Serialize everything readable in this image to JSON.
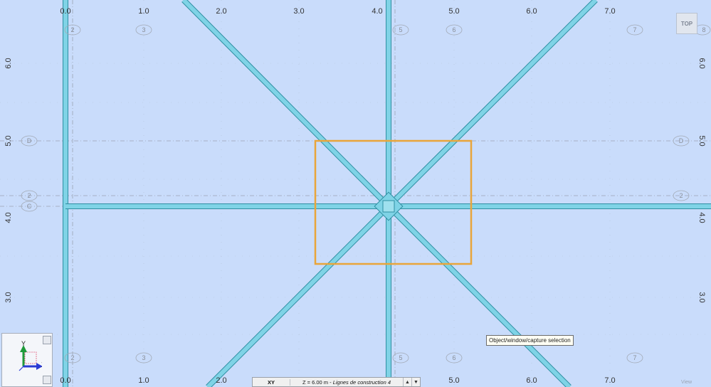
{
  "rulers": {
    "x_ticks": [
      "0.0",
      "1.0",
      "2.0",
      "3.0",
      "4.0",
      "5.0",
      "6.0",
      "7.0"
    ],
    "y_ticks": [
      "6.0",
      "5.0",
      "4.0",
      "3.0"
    ]
  },
  "grid_bubbles": {
    "top": [
      "2",
      "3",
      "5",
      "6",
      "7",
      "8"
    ],
    "left": [
      "D",
      "2",
      "C"
    ],
    "right": [
      "D",
      "2"
    ]
  },
  "view_cube": {
    "label": "TOP"
  },
  "tooltip": {
    "text": "Object/window/capture selection"
  },
  "axis_widget": {
    "y_label": "Y",
    "x_label": "X"
  },
  "status_bar": {
    "plane": "XY",
    "level_value": "Z = 6.00 m",
    "level_separator": " - ",
    "level_name": "Lignes de construction 4"
  },
  "view_label": "View",
  "colors": {
    "background": "#c9dcfb",
    "beam": "#7fd3e6",
    "beam_outline": "#2f8fa3",
    "selection": "#e9a53a",
    "gridline": "#9aa3b4"
  }
}
